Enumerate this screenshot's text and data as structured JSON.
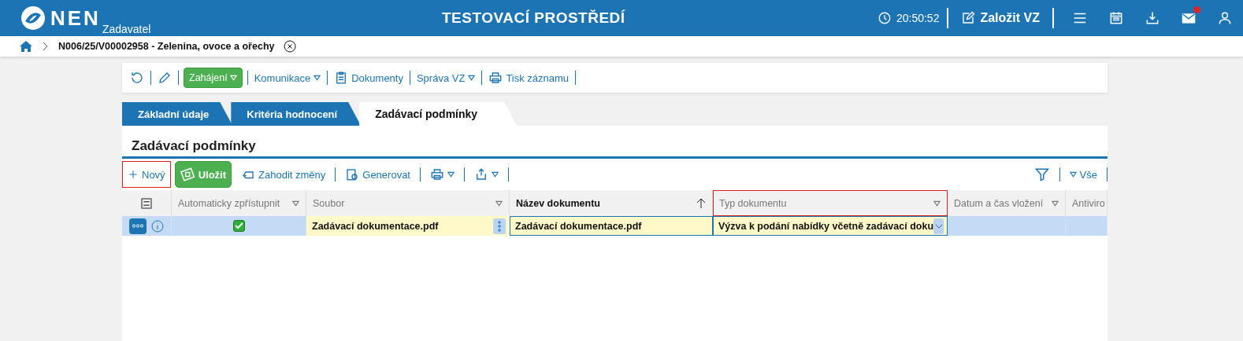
{
  "header": {
    "logo": "NEN",
    "subtitle": "Zadavatel",
    "env_title": "TESTOVACÍ PROSTŘEDÍ",
    "time": "20:50:52",
    "create_button": "Založit VZ",
    "mail_unread": true
  },
  "breadcrumb": {
    "title": "N006/25/V00002958 - Zelenina, ovoce a ořechy"
  },
  "actions": [
    {
      "kind": "refresh"
    },
    {
      "kind": "edit"
    },
    {
      "kind": "primary",
      "label": "Zahájení",
      "dropdown": true
    },
    {
      "kind": "link",
      "label": "Komunikace",
      "dropdown": true
    },
    {
      "kind": "documents",
      "label": "Dokumenty",
      "dropdown": false
    },
    {
      "kind": "link",
      "label": "Správa VZ",
      "dropdown": true
    },
    {
      "kind": "print",
      "label": "Tisk záznamu",
      "dropdown": false
    }
  ],
  "tabs": [
    {
      "label": "Základní údaje",
      "selected": false
    },
    {
      "label": "Kritéria hodnocení",
      "selected": false
    },
    {
      "label": "Zadávací podmínky",
      "selected": true
    }
  ],
  "section_title": "Zadávací podmínky",
  "grid_toolbar": [
    {
      "kind": "new",
      "label": "Nový",
      "highlighted": true
    },
    {
      "kind": "save",
      "label": "Uložit",
      "highlighted": false
    },
    {
      "kind": "discard",
      "label": "Zahodit změny",
      "highlighted": false
    },
    {
      "kind": "generate",
      "label": "Generovat",
      "highlighted": false
    },
    {
      "kind": "print",
      "highlighted": false
    },
    {
      "kind": "export",
      "highlighted": false
    }
  ],
  "filter_all": "Vše",
  "table": {
    "columns": [
      {
        "label": "Automaticky zpřístupnit",
        "sorted": false,
        "highlighted": false
      },
      {
        "label": "Soubor",
        "sorted": false,
        "highlighted": false
      },
      {
        "label": "Název dokumentu",
        "sorted": true,
        "highlighted": false
      },
      {
        "label": "Typ dokumentu",
        "sorted": false,
        "highlighted": true
      },
      {
        "label": "Datum a čas vložení",
        "sorted": false,
        "highlighted": false
      },
      {
        "label": "Antiviro",
        "sorted": false,
        "highlighted": false
      }
    ],
    "rows": [
      {
        "selected": true,
        "auto_publish": true,
        "file": "Zadávací dokumentace.pdf",
        "name": "Zadávací dokumentace.pdf",
        "type": "Výzva k podání nabídky včetně zadávací doku"
      }
    ]
  }
}
